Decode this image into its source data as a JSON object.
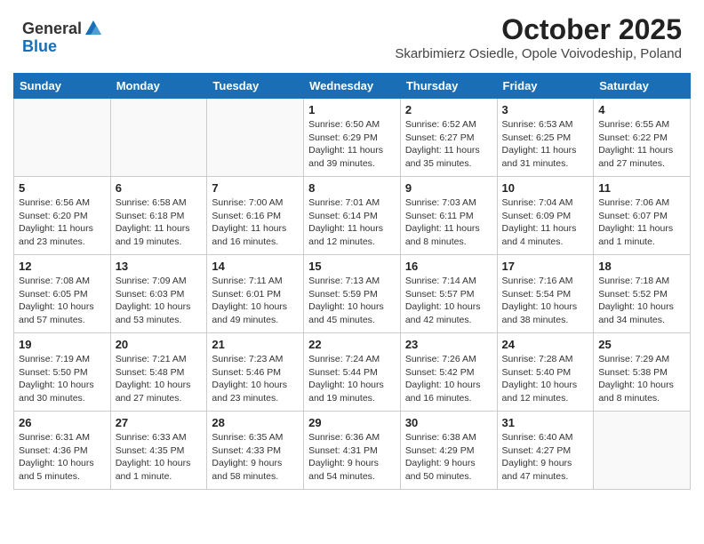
{
  "header": {
    "logo_general": "General",
    "logo_blue": "Blue",
    "month_title": "October 2025",
    "subtitle": "Skarbimierz Osiedle, Opole Voivodeship, Poland"
  },
  "weekdays": [
    "Sunday",
    "Monday",
    "Tuesday",
    "Wednesday",
    "Thursday",
    "Friday",
    "Saturday"
  ],
  "weeks": [
    [
      {
        "day": "",
        "text": ""
      },
      {
        "day": "",
        "text": ""
      },
      {
        "day": "",
        "text": ""
      },
      {
        "day": "1",
        "text": "Sunrise: 6:50 AM\nSunset: 6:29 PM\nDaylight: 11 hours\nand 39 minutes."
      },
      {
        "day": "2",
        "text": "Sunrise: 6:52 AM\nSunset: 6:27 PM\nDaylight: 11 hours\nand 35 minutes."
      },
      {
        "day": "3",
        "text": "Sunrise: 6:53 AM\nSunset: 6:25 PM\nDaylight: 11 hours\nand 31 minutes."
      },
      {
        "day": "4",
        "text": "Sunrise: 6:55 AM\nSunset: 6:22 PM\nDaylight: 11 hours\nand 27 minutes."
      }
    ],
    [
      {
        "day": "5",
        "text": "Sunrise: 6:56 AM\nSunset: 6:20 PM\nDaylight: 11 hours\nand 23 minutes."
      },
      {
        "day": "6",
        "text": "Sunrise: 6:58 AM\nSunset: 6:18 PM\nDaylight: 11 hours\nand 19 minutes."
      },
      {
        "day": "7",
        "text": "Sunrise: 7:00 AM\nSunset: 6:16 PM\nDaylight: 11 hours\nand 16 minutes."
      },
      {
        "day": "8",
        "text": "Sunrise: 7:01 AM\nSunset: 6:14 PM\nDaylight: 11 hours\nand 12 minutes."
      },
      {
        "day": "9",
        "text": "Sunrise: 7:03 AM\nSunset: 6:11 PM\nDaylight: 11 hours\nand 8 minutes."
      },
      {
        "day": "10",
        "text": "Sunrise: 7:04 AM\nSunset: 6:09 PM\nDaylight: 11 hours\nand 4 minutes."
      },
      {
        "day": "11",
        "text": "Sunrise: 7:06 AM\nSunset: 6:07 PM\nDaylight: 11 hours\nand 1 minute."
      }
    ],
    [
      {
        "day": "12",
        "text": "Sunrise: 7:08 AM\nSunset: 6:05 PM\nDaylight: 10 hours\nand 57 minutes."
      },
      {
        "day": "13",
        "text": "Sunrise: 7:09 AM\nSunset: 6:03 PM\nDaylight: 10 hours\nand 53 minutes."
      },
      {
        "day": "14",
        "text": "Sunrise: 7:11 AM\nSunset: 6:01 PM\nDaylight: 10 hours\nand 49 minutes."
      },
      {
        "day": "15",
        "text": "Sunrise: 7:13 AM\nSunset: 5:59 PM\nDaylight: 10 hours\nand 45 minutes."
      },
      {
        "day": "16",
        "text": "Sunrise: 7:14 AM\nSunset: 5:57 PM\nDaylight: 10 hours\nand 42 minutes."
      },
      {
        "day": "17",
        "text": "Sunrise: 7:16 AM\nSunset: 5:54 PM\nDaylight: 10 hours\nand 38 minutes."
      },
      {
        "day": "18",
        "text": "Sunrise: 7:18 AM\nSunset: 5:52 PM\nDaylight: 10 hours\nand 34 minutes."
      }
    ],
    [
      {
        "day": "19",
        "text": "Sunrise: 7:19 AM\nSunset: 5:50 PM\nDaylight: 10 hours\nand 30 minutes."
      },
      {
        "day": "20",
        "text": "Sunrise: 7:21 AM\nSunset: 5:48 PM\nDaylight: 10 hours\nand 27 minutes."
      },
      {
        "day": "21",
        "text": "Sunrise: 7:23 AM\nSunset: 5:46 PM\nDaylight: 10 hours\nand 23 minutes."
      },
      {
        "day": "22",
        "text": "Sunrise: 7:24 AM\nSunset: 5:44 PM\nDaylight: 10 hours\nand 19 minutes."
      },
      {
        "day": "23",
        "text": "Sunrise: 7:26 AM\nSunset: 5:42 PM\nDaylight: 10 hours\nand 16 minutes."
      },
      {
        "day": "24",
        "text": "Sunrise: 7:28 AM\nSunset: 5:40 PM\nDaylight: 10 hours\nand 12 minutes."
      },
      {
        "day": "25",
        "text": "Sunrise: 7:29 AM\nSunset: 5:38 PM\nDaylight: 10 hours\nand 8 minutes."
      }
    ],
    [
      {
        "day": "26",
        "text": "Sunrise: 6:31 AM\nSunset: 4:36 PM\nDaylight: 10 hours\nand 5 minutes."
      },
      {
        "day": "27",
        "text": "Sunrise: 6:33 AM\nSunset: 4:35 PM\nDaylight: 10 hours\nand 1 minute."
      },
      {
        "day": "28",
        "text": "Sunrise: 6:35 AM\nSunset: 4:33 PM\nDaylight: 9 hours\nand 58 minutes."
      },
      {
        "day": "29",
        "text": "Sunrise: 6:36 AM\nSunset: 4:31 PM\nDaylight: 9 hours\nand 54 minutes."
      },
      {
        "day": "30",
        "text": "Sunrise: 6:38 AM\nSunset: 4:29 PM\nDaylight: 9 hours\nand 50 minutes."
      },
      {
        "day": "31",
        "text": "Sunrise: 6:40 AM\nSunset: 4:27 PM\nDaylight: 9 hours\nand 47 minutes."
      },
      {
        "day": "",
        "text": ""
      }
    ]
  ]
}
